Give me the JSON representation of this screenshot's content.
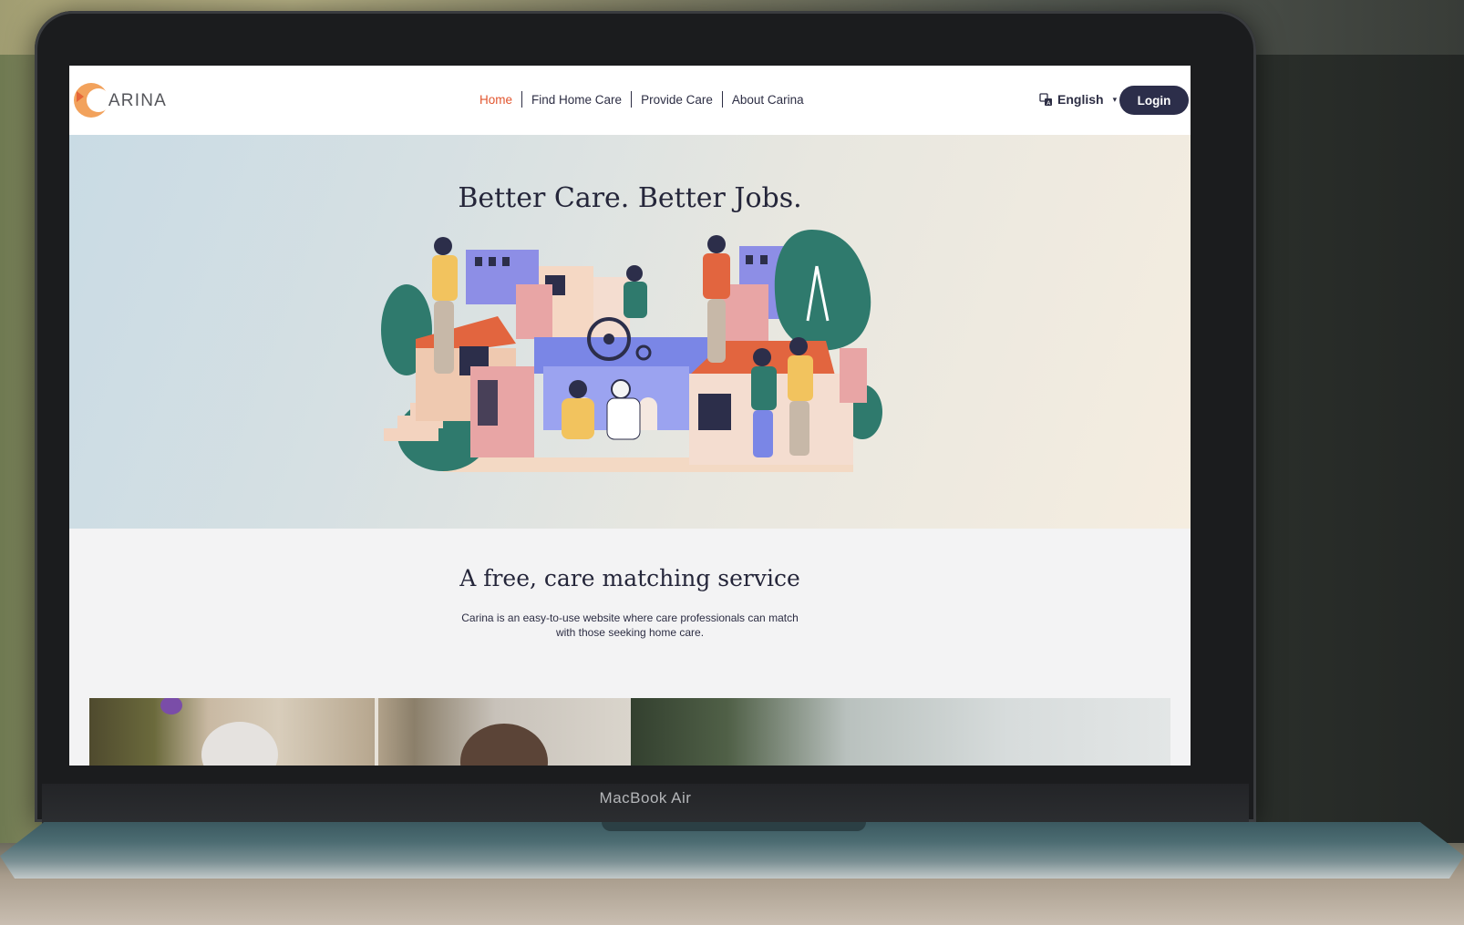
{
  "device": {
    "brand_label": "MacBook Air"
  },
  "header": {
    "logo_text": "CARINA",
    "nav": [
      {
        "label": "Home",
        "active": true
      },
      {
        "label": "Find Home Care",
        "active": false
      },
      {
        "label": "Provide Care",
        "active": false
      },
      {
        "label": "About Carina",
        "active": false
      }
    ],
    "language": {
      "icon": "translate-icon",
      "label": "English"
    },
    "login_label": "Login"
  },
  "hero": {
    "title": "Better Care. Better Jobs."
  },
  "section": {
    "title": "A free, care matching service",
    "description_line1": "Carina is an easy-to-use website where care professionals can match",
    "description_line2": "with those seeking home care."
  },
  "colors": {
    "accent": "#e2562f",
    "navy": "#2c2e4a",
    "logo_orange": "#f2a25c"
  }
}
